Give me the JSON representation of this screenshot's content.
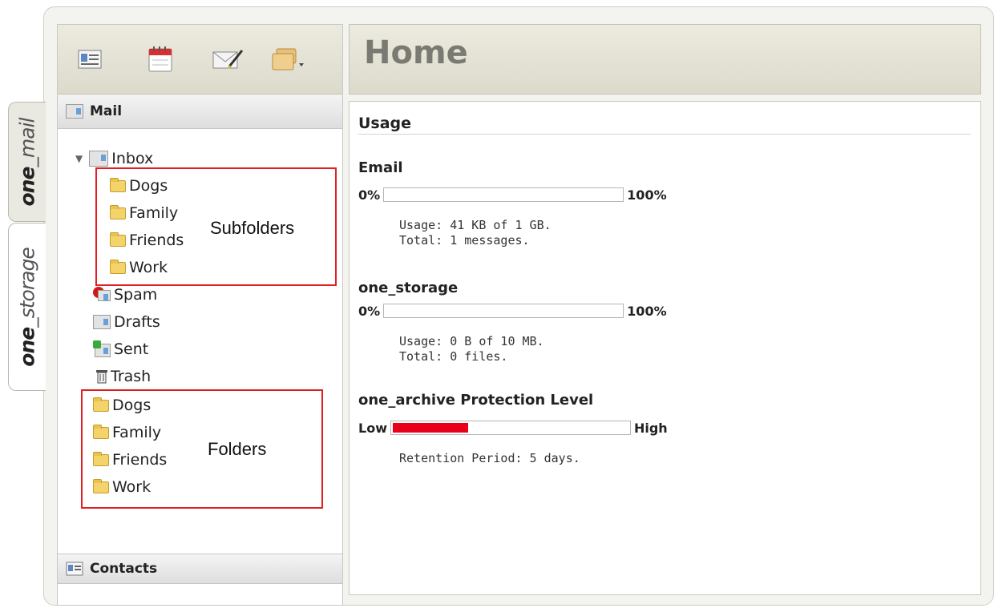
{
  "side_tabs": [
    {
      "bold": "one",
      "rest": "_mail"
    },
    {
      "bold": "one",
      "rest": "_storage"
    }
  ],
  "toolbar": {
    "icons": [
      "contacts-card-icon",
      "calendar-icon",
      "compose-mail-icon",
      "folders-menu-icon"
    ]
  },
  "mail_header": {
    "label": "Mail"
  },
  "tree": {
    "inbox": "Inbox",
    "subfolders": [
      "Dogs",
      "Family",
      "Friends",
      "Work"
    ],
    "system": [
      "Spam",
      "Drafts",
      "Sent",
      "Trash"
    ],
    "folders": [
      "Dogs",
      "Family",
      "Friends",
      "Work"
    ]
  },
  "contacts_header": {
    "label": "Contacts"
  },
  "main": {
    "title": "Home",
    "usage_title": "Usage",
    "email": {
      "title": "Email",
      "min_label": "0%",
      "max_label": "100%",
      "fill_fraction": 0.0,
      "usage_line": "Usage: 41 KB of 1 GB.",
      "total_line": "Total: 1 messages."
    },
    "storage": {
      "title": "one_storage",
      "min_label": "0%",
      "max_label": "100%",
      "fill_fraction": 0.0,
      "usage_line": "Usage: 0 B of 10 MB.",
      "total_line": "Total: 0 files."
    },
    "archive": {
      "title": "one_archive Protection Level",
      "min_label": "Low",
      "max_label": "High",
      "fill_fraction": 0.33,
      "fill_color": "#e8001a",
      "retention_line": "Retention Period: 5 days."
    }
  },
  "annotations": {
    "subfolders_label": "Subfolders",
    "folders_label": "Folders",
    "box_color": "#e02020"
  }
}
